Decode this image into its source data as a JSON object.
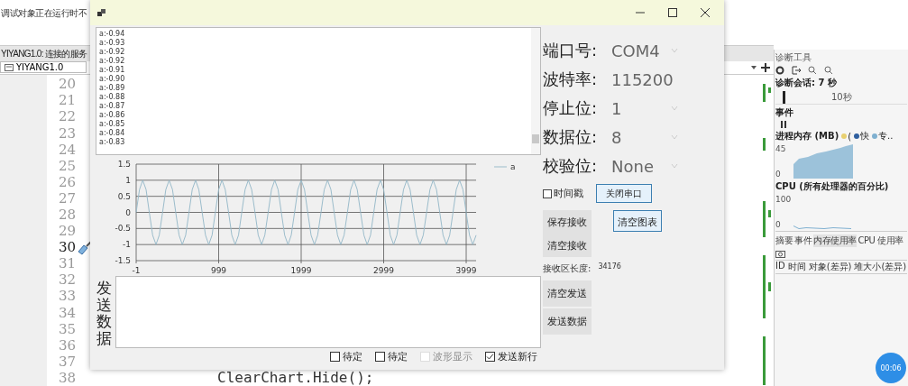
{
  "ide": {
    "output_text": "调试对象正在运行时不",
    "service_bar": "YIYANG1.0: 连接的服务",
    "project_dropdown": "YIYANG1.0",
    "editor_lines": [
      {
        "number": "20",
        "marked": false
      },
      {
        "number": "21",
        "marked": false
      },
      {
        "number": "22",
        "marked": false
      },
      {
        "number": "23",
        "marked": false
      },
      {
        "number": "24",
        "marked": false
      },
      {
        "number": "25",
        "marked": false
      },
      {
        "number": "26",
        "marked": false
      },
      {
        "number": "27",
        "marked": false
      },
      {
        "number": "28",
        "marked": false
      },
      {
        "number": "29",
        "marked": false
      },
      {
        "number": "30",
        "marked": true
      },
      {
        "number": "31",
        "marked": false
      },
      {
        "number": "32",
        "marked": false
      },
      {
        "number": "33",
        "marked": false
      },
      {
        "number": "34",
        "marked": false
      },
      {
        "number": "35",
        "marked": false
      },
      {
        "number": "36",
        "marked": false
      },
      {
        "number": "37",
        "marked": false
      },
      {
        "number": "38",
        "marked": false,
        "code": "ClearChart.Hide();"
      }
    ]
  },
  "diagnostics": {
    "title": "诊断工具",
    "session": "诊断会话: 7 秒",
    "timeline_label": "10秒",
    "events_section": "事件",
    "memory_section": "进程内存 (MB)",
    "memory_legend": [
      {
        "label": "(",
        "color": "#e8d070"
      },
      {
        "label": "快",
        "color": "#2f5f9f"
      },
      {
        "label": "专..",
        "color": "#7fb0d0"
      }
    ],
    "memory_axis": [
      "45",
      "0"
    ],
    "cpu_section": "CPU (所有处理器的百分比)",
    "cpu_axis": [
      "100",
      "0"
    ],
    "tabs": [
      {
        "label": "摘要",
        "selected": false
      },
      {
        "label": "事件",
        "selected": false
      },
      {
        "label": "内存使用率",
        "selected": true
      },
      {
        "label": "CPU 使用率",
        "selected": false
      }
    ],
    "columns": [
      "ID",
      "时间",
      "对象(差异)",
      "堆大小(差异)"
    ]
  },
  "timer_badge": "00:06",
  "dialog": {
    "receive_lines": [
      "a:-0.94",
      "a:-0.93",
      "a:-0.92",
      "a:-0.92",
      "a:-0.91",
      "a:-0.90",
      "a:-0.89",
      "a:-0.88",
      "a:-0.87",
      "a:-0.86",
      "a:-0.85",
      "a:-0.84",
      "a:-0.83"
    ],
    "chart_data": {
      "type": "line",
      "grid": true,
      "xlim": [
        -1,
        4119
      ],
      "ylim": [
        -1.5,
        1.5
      ],
      "xticks": [
        -1,
        999,
        1999,
        2999,
        3999
      ],
      "yticks": [
        -1.5,
        -1,
        -0.5,
        0,
        0.5,
        1,
        1.5
      ],
      "x": [
        -1,
        39,
        79,
        119,
        159,
        199,
        239,
        279,
        319,
        359,
        399,
        439,
        479,
        519,
        559,
        599,
        639,
        679,
        719,
        759,
        799,
        839,
        879,
        919,
        959,
        999,
        1039,
        1079,
        1119,
        1159,
        1199,
        1239,
        1279,
        1319,
        1359,
        1399,
        1439,
        1479,
        1519,
        1559,
        1599,
        1639,
        1679,
        1719,
        1759,
        1799,
        1839,
        1879,
        1919,
        1959,
        1999,
        2039,
        2079,
        2119,
        2159,
        2199,
        2239,
        2279,
        2319,
        2359,
        2399,
        2439,
        2479,
        2519,
        2559,
        2599,
        2639,
        2679,
        2719,
        2759,
        2799,
        2839,
        2879,
        2919,
        2959,
        2999,
        3039,
        3079,
        3119,
        3159,
        3199,
        3239,
        3279,
        3319,
        3359,
        3399,
        3439,
        3479,
        3519,
        3559,
        3599,
        3639,
        3679,
        3719,
        3759,
        3799,
        3839,
        3879,
        3919,
        3959,
        3999,
        4039,
        4079,
        4119
      ],
      "series": [
        {
          "name": "a",
          "color": "#9bbccb",
          "values": [
            0,
            0.71,
            1,
            0.71,
            0,
            -0.71,
            -1,
            -0.71,
            0,
            0.71,
            1,
            0.71,
            0,
            -0.71,
            -1,
            -0.71,
            0,
            0.71,
            1,
            0.71,
            0,
            -0.71,
            -1,
            -0.71,
            0,
            0.71,
            1,
            0.71,
            0,
            -0.71,
            -1,
            -0.71,
            0,
            0.71,
            1,
            0.71,
            0,
            -0.71,
            -1,
            -0.71,
            0,
            0.71,
            1,
            0.71,
            0,
            -0.71,
            -1,
            -0.71,
            0,
            0.71,
            1,
            0.71,
            0,
            -0.71,
            -1,
            -0.71,
            0,
            0.71,
            1,
            0.71,
            0,
            -0.71,
            -1,
            -0.71,
            0,
            0.71,
            1,
            0.71,
            0,
            -0.71,
            -1,
            -0.71,
            0,
            0.71,
            1,
            0.71,
            0,
            -0.71,
            -1,
            -0.71,
            0,
            0.71,
            1,
            0.71,
            0,
            -0.71,
            -1,
            -0.71,
            0,
            0.71,
            1,
            0.71,
            0,
            -0.71,
            -1,
            -0.71,
            0,
            0.71,
            1,
            0.71,
            0,
            -0.71,
            -1,
            -0.71
          ]
        }
      ]
    },
    "settings": [
      {
        "label": "端口号:",
        "value": "COM4",
        "kind": "dropdown"
      },
      {
        "label": "波特率:",
        "value": "115200",
        "kind": "text"
      },
      {
        "label": "停止位:",
        "value": "1",
        "kind": "dropdown"
      },
      {
        "label": "数据位:",
        "value": "8",
        "kind": "dropdown"
      },
      {
        "label": "校验位:",
        "value": "None",
        "kind": "dropdown"
      }
    ],
    "timestamp": {
      "label": "时间戳",
      "checked": false
    },
    "close_port_button": {
      "label": "关闭串口",
      "highlighted": true
    },
    "save_receive_button": {
      "label": "保存接收",
      "highlighted": false
    },
    "clear_chart_button": {
      "label": "清空图表",
      "highlighted": true
    },
    "clear_receive_button": {
      "label": "清空接收",
      "highlighted": false
    },
    "receive_length_label": "接收区长度:",
    "receive_length_value": "34176",
    "send_label": "发送数据",
    "clear_send_button": {
      "label": "清空发送",
      "highlighted": false
    },
    "send_data_button": {
      "label": "发送数据",
      "highlighted": false
    },
    "options": [
      {
        "label": "待定",
        "checked": false,
        "disabled": false
      },
      {
        "label": "待定",
        "checked": false,
        "disabled": false
      },
      {
        "label": "波形显示",
        "checked": false,
        "disabled": true
      },
      {
        "label": "发送新行",
        "checked": true,
        "disabled": false
      }
    ]
  }
}
